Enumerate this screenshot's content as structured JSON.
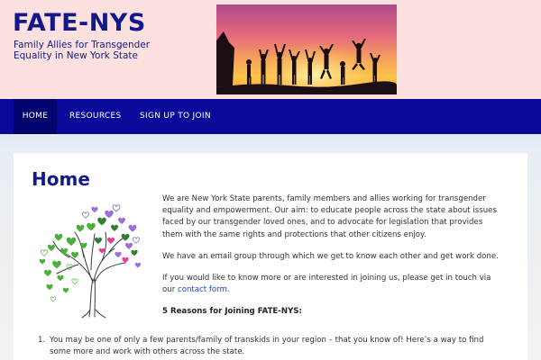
{
  "header": {
    "title": "FATE-NYS",
    "tagline": "Family Allies for Transgender Equality in New York State"
  },
  "nav": {
    "items": [
      {
        "label": "HOME"
      },
      {
        "label": "RESOURCES"
      },
      {
        "label": "SIGN UP TO JOIN"
      }
    ]
  },
  "main": {
    "title": "Home",
    "paragraphs": {
      "intro": "We are New York State parents, family members and allies working for transgender equality and empowerment. Our aim: to educate people across the state about issues faced by our transgender loved ones, and to advocate for legislation that provides them with the same rights and protections that other citizens enjoy.",
      "email_group": "We have an email group through which we get to know each other and get work done.",
      "contact_prefix": "If you would like to know more or are interested in joining us, please get in touch via our",
      "contact_link": "contact form",
      "contact_suffix": "."
    },
    "reasons_heading": "5 Reasons for Joining FATE-NYS:",
    "reasons": [
      {
        "number": "1.",
        "text": "You may be one of only a few parents/family of transkids in your region – that you know of! Here’s a way to find some more and work with others across the state."
      }
    ]
  },
  "colors": {
    "header_bg": "#fde1df",
    "brand_blue": "#12198c",
    "nav_bg": "#0a0a9a",
    "nav_active_bg": "#03036e",
    "link": "#1a3fc9"
  },
  "images": {
    "banner": "silhouettes-of-people-jumping-at-sunset",
    "tree": "tree-with-heart-leaves-illustration"
  }
}
